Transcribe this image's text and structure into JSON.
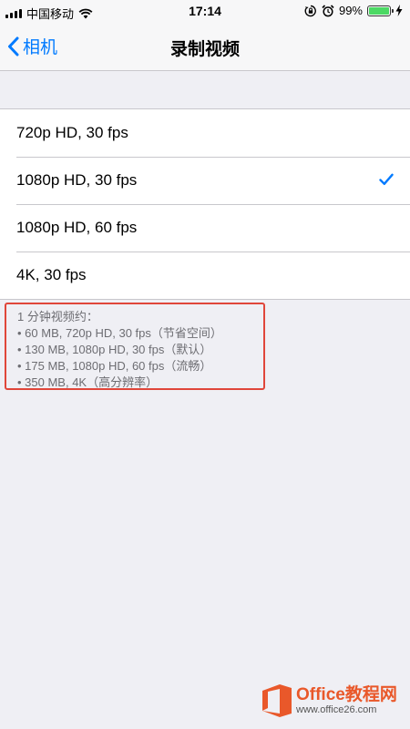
{
  "status_bar": {
    "carrier": "中国移动",
    "time": "17:14",
    "battery_percent": "99%",
    "battery_level": 0.99,
    "icons": [
      "signal-icon",
      "wifi-icon",
      "rotation-lock-icon",
      "alarm-icon",
      "battery-icon",
      "charging-icon"
    ]
  },
  "nav": {
    "back_label": "相机",
    "title": "录制视频"
  },
  "options": [
    {
      "label": "720p HD, 30 fps",
      "selected": false
    },
    {
      "label": "1080p HD, 30 fps",
      "selected": true
    },
    {
      "label": "1080p HD, 60 fps",
      "selected": false
    },
    {
      "label": "4K, 30 fps",
      "selected": false
    }
  ],
  "footer": {
    "heading": "1 分钟视频约：",
    "lines": [
      "• 60 MB, 720p HD, 30 fps（节省空间）",
      "• 130 MB, 1080p HD, 30 fps（默认）",
      "• 175 MB, 1080p HD, 60 fps（流畅）",
      "• 350 MB, 4K（高分辨率）"
    ]
  },
  "watermark": {
    "title": "Office教程网",
    "url": "www.office26.com"
  },
  "colors": {
    "accent": "#007aff",
    "background": "#efeff4",
    "highlight_border": "#e0463a",
    "watermark_orange": "#e9582a",
    "battery_green": "#4cd964"
  }
}
